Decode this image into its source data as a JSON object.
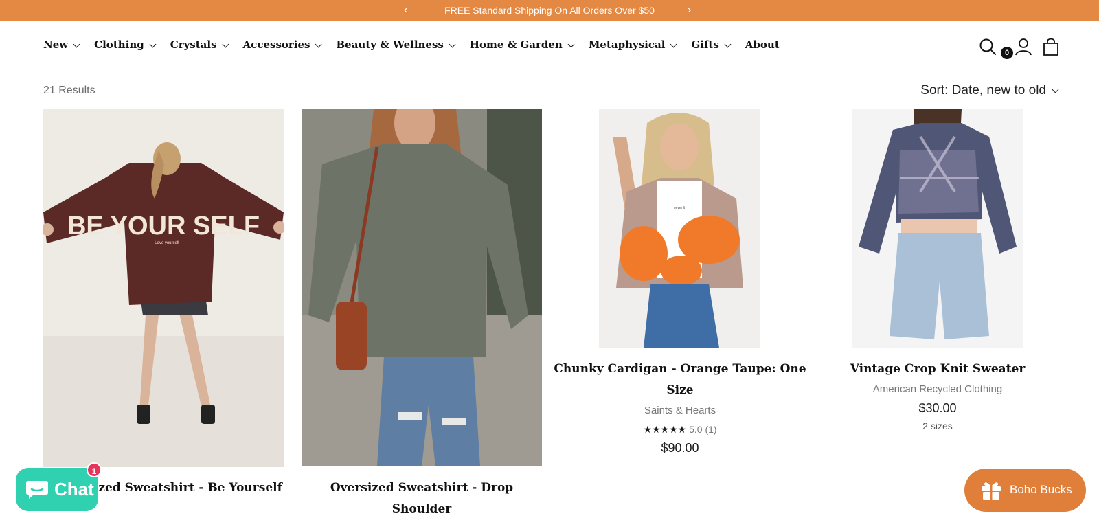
{
  "announcement": {
    "text": "FREE Standard Shipping On All Orders Over $50",
    "prev_icon": "chevron-left-icon",
    "next_icon": "chevron-right-icon"
  },
  "nav": {
    "items": [
      {
        "label": "New",
        "dropdown": true
      },
      {
        "label": "Clothing",
        "dropdown": true
      },
      {
        "label": "Crystals",
        "dropdown": true
      },
      {
        "label": "Accessories",
        "dropdown": true
      },
      {
        "label": "Beauty & Wellness",
        "dropdown": true
      },
      {
        "label": "Home & Garden",
        "dropdown": true
      },
      {
        "label": "Metaphysical",
        "dropdown": true
      },
      {
        "label": "Gifts",
        "dropdown": true
      },
      {
        "label": "About",
        "dropdown": false
      }
    ]
  },
  "header_icons": {
    "search": "search-icon",
    "account": "account-icon",
    "cart": "cart-icon",
    "cart_count": "0"
  },
  "toolbar": {
    "results": "21 Results",
    "sort": "Sort: Date, new to old"
  },
  "products": [
    {
      "title": "d Oversized Sweatshirt - Be Yourself",
      "image_text_big": "BE YOUR SELF",
      "image_text_small": "Love yourself"
    },
    {
      "title": "Oversized Sweatshirt - Drop Shoulder"
    },
    {
      "title": "Chunky Cardigan - Orange Taupe: One Size",
      "vendor": "Saints & Hearts",
      "stars": "★★★★★",
      "rating": "5.0 (1)",
      "price": "$90.00",
      "image_text_small": "never lt"
    },
    {
      "title": "Vintage Crop Knit Sweater",
      "vendor": "American Recycled Clothing",
      "price": "$30.00",
      "sizes": "2 sizes"
    }
  ],
  "chat": {
    "label": "Chat",
    "badge": "1",
    "color": "#2fd1b1"
  },
  "boho": {
    "label": "Boho Bucks",
    "color": "#e07f3a"
  },
  "colors": {
    "announcement_bg": "#e38944"
  }
}
